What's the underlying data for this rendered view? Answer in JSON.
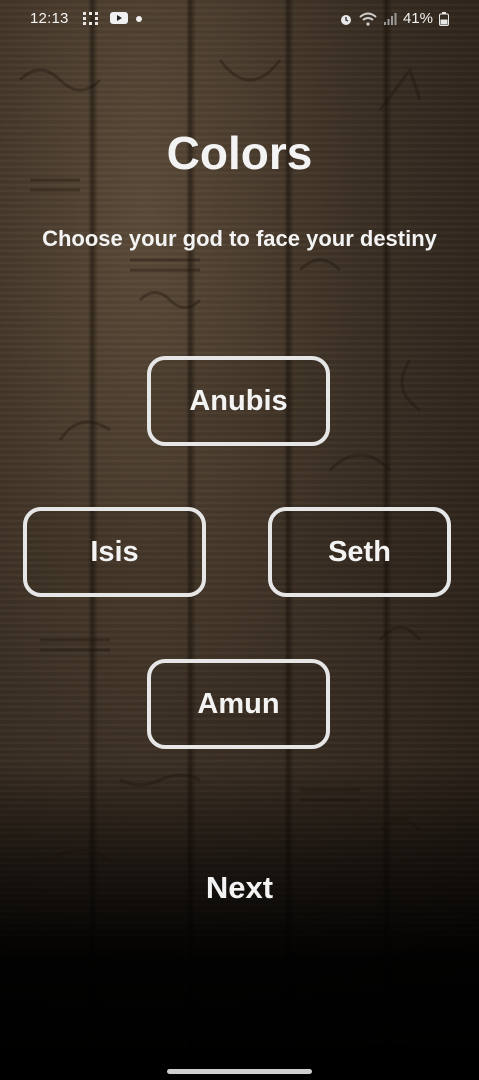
{
  "status_bar": {
    "time": "12:13",
    "battery": "41%"
  },
  "screen": {
    "title": "Colors",
    "subtitle": "Choose your god to face your destiny"
  },
  "gods": {
    "anubis": "Anubis",
    "isis": "Isis",
    "seth": "Seth",
    "amun": "Amun"
  },
  "actions": {
    "next": "Next"
  },
  "icons": [
    "grid-icon",
    "youtube-icon",
    "dot-icon",
    "alarm-icon",
    "wifi-icon",
    "signal-icon",
    "battery-icon"
  ],
  "colors": {
    "text": "#f3f3f3",
    "button_border": "#e6e6e6"
  }
}
